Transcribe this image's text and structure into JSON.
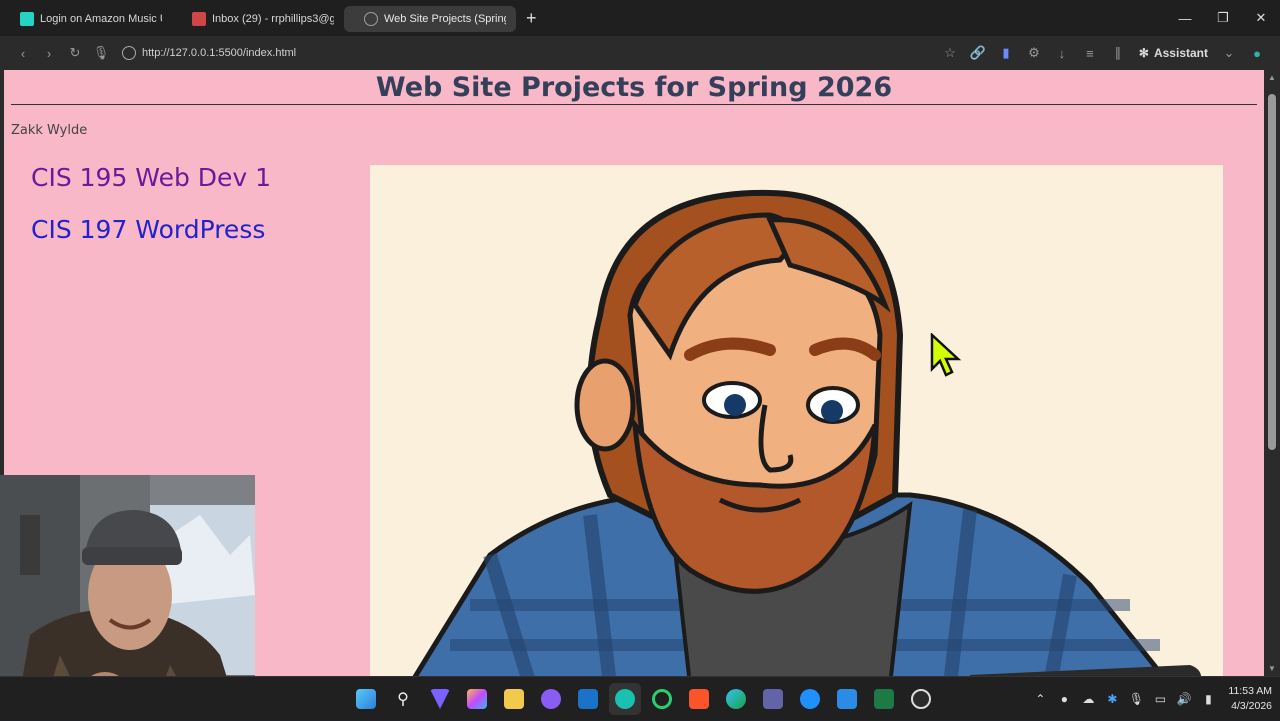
{
  "browser": {
    "tabs": [
      {
        "label": "Login on Amazon Music U",
        "favicon_color": "#24d4c4"
      },
      {
        "label": "Inbox (29) - rrphillips3@gr",
        "favicon_color": "#d04545"
      },
      {
        "label": "Web Site Projects (Spring",
        "favicon_color": "#9aa0a6",
        "active": true
      }
    ],
    "new_tab_label": "+",
    "url": "http://127.0.0.1:5500/index.html",
    "assistant_label": "Assistant"
  },
  "page": {
    "title": "Web Site Projects for Spring 2026",
    "author": "Zakk Wylde",
    "links": [
      {
        "label": "CIS 195 Web Dev 1",
        "state": "visited"
      },
      {
        "label": "CIS 197 WordPress",
        "state": "unvisited"
      }
    ],
    "image_desc_icon": "cartoon-portrait"
  },
  "taskbar": {
    "clock_time": "11:53 AM",
    "clock_date": "4/3/2026"
  },
  "colors": {
    "page_bg": "#f8b8c8",
    "title_color": "#34405a",
    "visited_link": "#6a1a9a",
    "link": "#2222cc",
    "portrait_bg": "#fbf0dc"
  }
}
